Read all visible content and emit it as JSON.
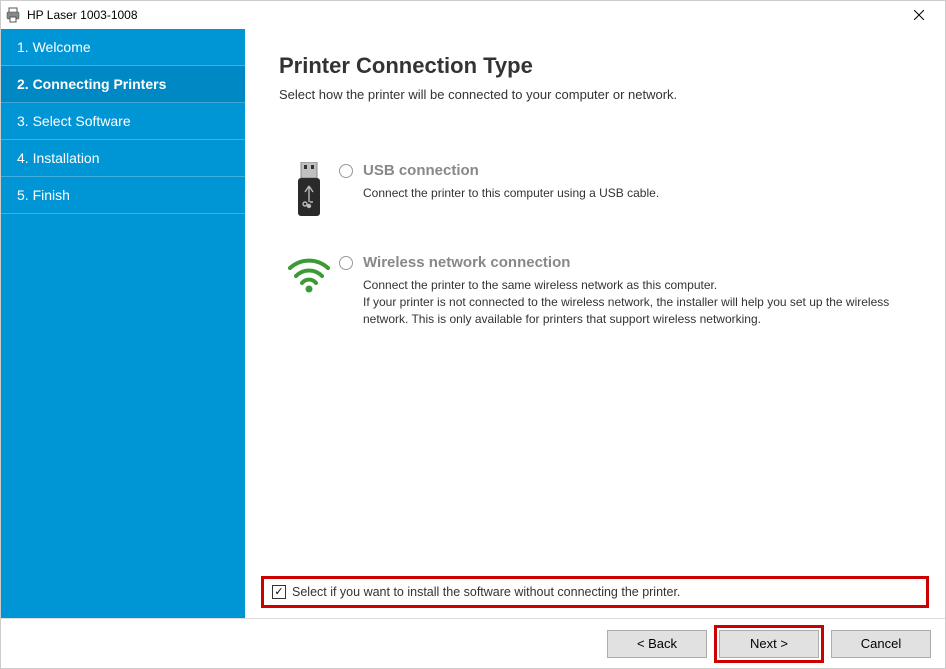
{
  "titlebar": {
    "title": "HP Laser 1003-1008"
  },
  "sidebar": {
    "items": [
      {
        "label": "1. Welcome"
      },
      {
        "label": "2. Connecting Printers"
      },
      {
        "label": "3. Select Software"
      },
      {
        "label": "4. Installation"
      },
      {
        "label": "5. Finish"
      }
    ]
  },
  "page": {
    "title": "Printer Connection Type",
    "subtitle": "Select how the printer will be connected to your computer or network."
  },
  "options": {
    "usb": {
      "label": "USB connection",
      "desc": "Connect the printer to this computer using a USB cable."
    },
    "wireless": {
      "label": "Wireless network connection",
      "desc": "Connect the printer to the same wireless network as this computer.\nIf your printer is not connected to the wireless network, the installer will help you set up the wireless network. This is only available for printers that support wireless networking."
    }
  },
  "checkbox": {
    "label": "Select if you want to install the software without connecting the printer.",
    "checked_glyph": "✓"
  },
  "footer": {
    "back": "< Back",
    "next": "Next >",
    "cancel": "Cancel"
  }
}
